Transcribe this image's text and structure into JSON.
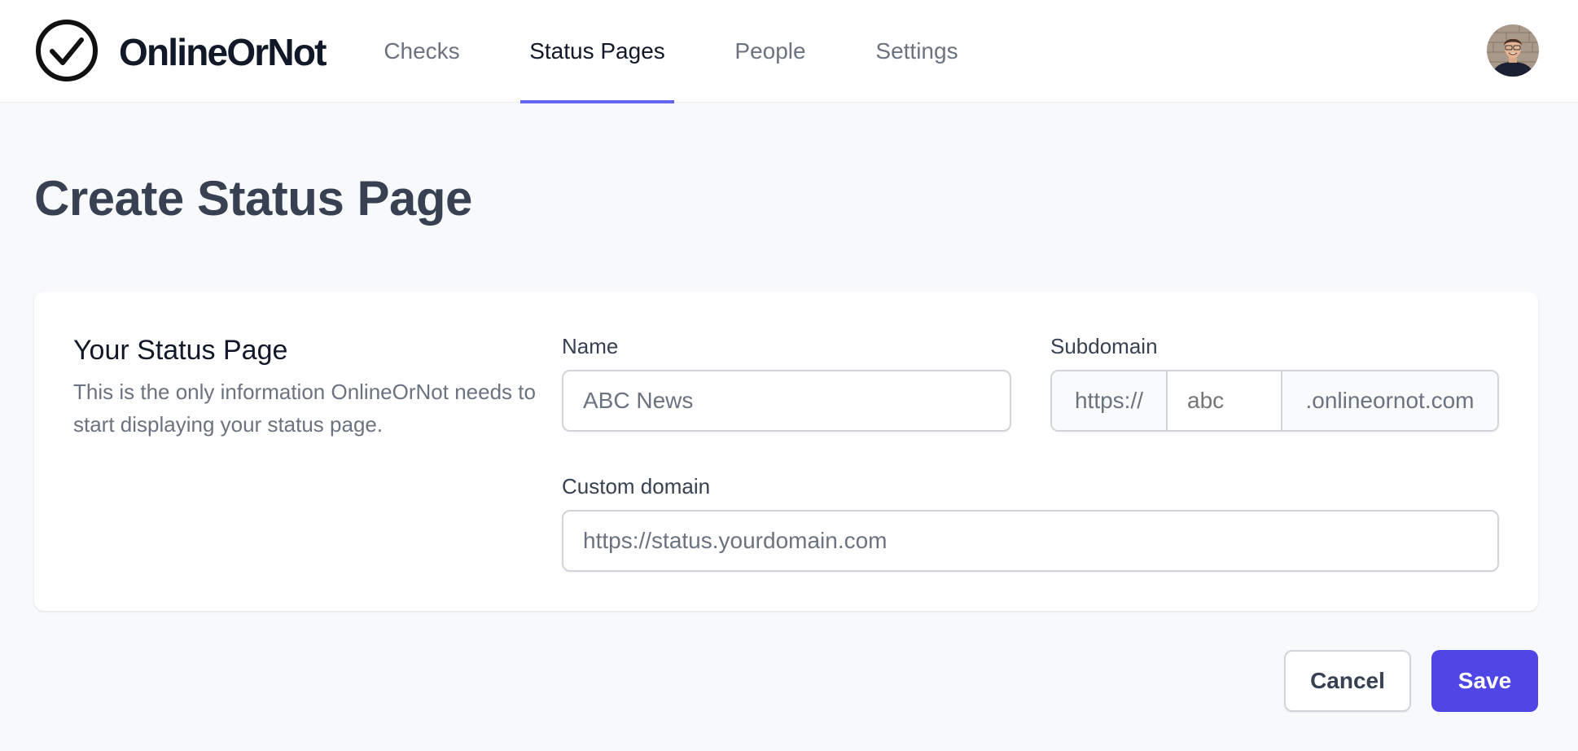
{
  "app": {
    "name": "OnlineOrNot",
    "logo_icon": "check-circle-icon"
  },
  "nav": {
    "tabs": [
      {
        "label": "Checks",
        "active": false
      },
      {
        "label": "Status Pages",
        "active": true
      },
      {
        "label": "People",
        "active": false
      },
      {
        "label": "Settings",
        "active": false
      }
    ],
    "accent_color": "#6366f1"
  },
  "user": {
    "avatar_alt": "User avatar"
  },
  "page": {
    "title": "Create Status Page"
  },
  "form": {
    "section_title": "Your Status Page",
    "section_description": "This is the only information OnlineOrNot needs to start displaying your status page.",
    "name": {
      "label": "Name",
      "placeholder": "ABC News",
      "value": ""
    },
    "subdomain": {
      "label": "Subdomain",
      "prefix": "https://",
      "placeholder": "abc",
      "value": "",
      "suffix": ".onlineornot.com"
    },
    "custom_domain": {
      "label": "Custom domain",
      "placeholder": "https://status.yourdomain.com",
      "value": ""
    }
  },
  "actions": {
    "cancel_label": "Cancel",
    "save_label": "Save",
    "primary_color": "#4f46e5"
  }
}
